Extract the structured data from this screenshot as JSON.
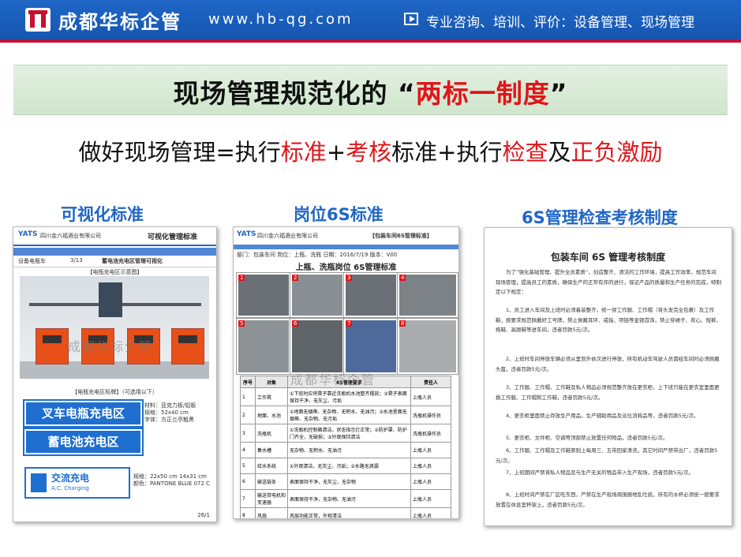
{
  "header": {
    "brand": "成都华标企管",
    "url": "www.hb-qg.com",
    "tagline": "专业咨询、培训、评价：设备管理、现场管理",
    "accent": "#1f66c6",
    "stripe": "#c8102e"
  },
  "title": {
    "prefix": "现场管理规范化的",
    "open_quote": "“",
    "highlight": "两标一制度",
    "close_quote": "”"
  },
  "subtitle": {
    "p1": "做好现场管理=执行",
    "p2": "标准",
    "p3": "+",
    "p4": "考核",
    "p5": "标准+执行",
    "p6": "检查",
    "p7": "及",
    "p8": "正负激励"
  },
  "sections": [
    {
      "label": "可视化标准"
    },
    {
      "label": "岗位6S标准"
    },
    {
      "label": "6S管理检查考核制度"
    }
  ],
  "card1": {
    "company": "四川金六福酒业有限公司",
    "doc_name": "可视化管理标准",
    "row_label": "设备电瓶车",
    "page": "3/13",
    "row_title": "蓄电池充电区管理可视化",
    "caption_top": "【电瓶充电区示意图】",
    "sign1": "叉车电瓶充电区",
    "sign2": "蓄电池充电区",
    "caption_mid": "【电瓶充电区标牌】（可选用以下）",
    "spec1": "材料：亚克力板/铝板",
    "spec2": "规格：52x40 cm",
    "spec3": "字体：方正兰亭粗黑",
    "sign3_cn": "交流充电",
    "sign3_en": "A.C. Charging",
    "spec4": "规格：22x50 cm  14x31 cm",
    "spec5": "颜色：PANTONE BLUE 072 C",
    "page_foot": "26/1"
  },
  "card2": {
    "company": "四川金六福酒业有限公司",
    "doc_name": "【包装车间6S管理标准】",
    "meta": "部门：包装车间  岗位：上瓶、洗瓶  日期：2016/7/19  版本：V00",
    "title": "上瓶、洗瓶岗位 6S管理标准",
    "table_title": "6S管理要求",
    "headers": [
      "序号",
      "对象",
      "6S管理要求",
      "责任人"
    ],
    "rows": [
      {
        "no": "1",
        "obj": "工作凳",
        "req": "①下班时应将凳子靠近洗瓶机水池整齐摆放；②凳子表面保持干净，无灰尘、污垢",
        "owner": "上瓶人员"
      },
      {
        "no": "2",
        "obj": "地面、水池",
        "req": "①地面无烟蒂、无杂物、无积水、无油污；②水池里面无烟蒂、无杂物、无污垢",
        "owner": "洗瓶机操作员"
      },
      {
        "no": "3",
        "obj": "洗瓶机",
        "req": "①洗瓶机控制箱清洁，状态指示灯正常；②防护罩、防护门齐全，无破损；③外观保持清洁",
        "owner": "洗瓶机操作员"
      },
      {
        "no": "4",
        "obj": "集水槽",
        "req": "无杂物、无积水、无油污",
        "owner": "上瓶人员"
      },
      {
        "no": "5",
        "obj": "给水系统",
        "req": "①外观清洁，无灰尘、污垢；②水路无滴漏",
        "owner": "上瓶人员"
      },
      {
        "no": "6",
        "obj": "输送链条",
        "req": "表面保持干净，无灰尘、无杂物",
        "owner": "上瓶人员"
      },
      {
        "no": "7",
        "obj": "输送带电机和变速器",
        "req": "表面保持干净，无杂物、无油污",
        "owner": "上瓶人员"
      },
      {
        "no": "8",
        "obj": "风扇",
        "req": "风扇功能正常，外观清洁",
        "owner": "上瓶人员"
      }
    ]
  },
  "card3": {
    "doc_title": "包装车间 6S 管理考核制度",
    "paragraphs": [
      "为了“强化基础管理、提升全员素质”，创造整齐、清洁的工作环境，提高工作效率，规范车间现场管理，提高员工的素质，确保生产的正常有序的进行，保证产品的质量和生产任务的完成，特制定以下规定：",
      "1、员工进入车间及上班时必须着装整齐，统一穿工作服、工作帽（将头发完全包裹）及工作鞋，按要求规范佩戴好工号牌，禁止佩戴耳环、戒指、项链等金银首饰，禁止穿裙子、背心、短裤、拖鞋、高跟鞋等进车间，违者罚款5元/次。",
      "2、上班时车间停放车辆必须从里到外依次进行停放，所有机动车驾驶人员需经车间时必须佩戴头盔，违者罚款5元/次。",
      "3、工作服、工作帽、工作鞋及私人物品必须规范整齐放在更衣柜，上下班只能在更衣室里面更换工作服、工作帽和工作鞋，违者罚款5元/次。",
      "4、更衣柜里面禁止存放生产用品，生产辅助用品及派位消耗品等，违者罚款5元/次。",
      "5、更衣柜、文件柜、空调等顶部禁止放置任何物品，违者罚款5元/次。",
      "6、工作服、工作帽及工作鞋原则上每周三、五带回家清洗，其它时间严禁带出厂，违者罚款5元/次。",
      "7、上班期间严禁将私人物品及与生产无关的物品带入生产现场，违者罚款5元/次。",
      "8、上班时间严禁在厂区吃东西，严禁在生产现场周围随地乱吐痰，所有的水杯必须统一按要求放置在休息室杯架上，违者罚款5元/次。"
    ]
  },
  "watermark": "成都华标企管"
}
